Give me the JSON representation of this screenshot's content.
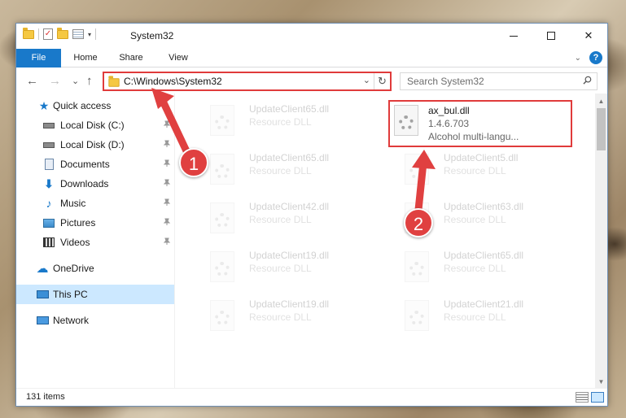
{
  "window": {
    "title": "System32",
    "qat_dropdown": "▾",
    "minimize_label": "",
    "maximize_label": "",
    "close_label": "✕"
  },
  "ribbon": {
    "tabs": [
      "File",
      "Home",
      "Share",
      "View"
    ],
    "collapse_chevron": "⌄",
    "help": "?"
  },
  "nav": {
    "back": "←",
    "forward": "→",
    "recent": "⌄",
    "up": "↑",
    "address": "C:\\Windows\\System32",
    "address_dropdown": "⌄",
    "refresh": "↻",
    "search_placeholder": "Search System32"
  },
  "sidebar": {
    "items": [
      {
        "label": "Quick access",
        "icon": "star-icon"
      },
      {
        "label": "Local Disk (C:)",
        "icon": "disk-icon",
        "pinned": true
      },
      {
        "label": "Local Disk (D:)",
        "icon": "disk-icon",
        "pinned": true
      },
      {
        "label": "Documents",
        "icon": "document-icon",
        "pinned": true
      },
      {
        "label": "Downloads",
        "icon": "download-icon",
        "pinned": true
      },
      {
        "label": "Music",
        "icon": "music-icon",
        "pinned": true
      },
      {
        "label": "Pictures",
        "icon": "pictures-icon",
        "pinned": true
      },
      {
        "label": "Videos",
        "icon": "videos-icon",
        "pinned": true
      },
      {
        "label": "OneDrive",
        "icon": "cloud-icon"
      },
      {
        "label": "This PC",
        "icon": "computer-icon",
        "selected": true
      },
      {
        "label": "Network",
        "icon": "network-icon"
      }
    ]
  },
  "files": [
    {
      "name": "UpdateClient65.dll",
      "type": "Resource DLL"
    },
    {
      "name": "ax_bul.dll",
      "version": "1.4.6.703",
      "description": "Alcohol multi-langu...",
      "highlighted": true
    },
    {
      "name": "UpdateClient65.dll",
      "type": "Resource DLL"
    },
    {
      "name": "UpdateClient5.dll",
      "type": "Resource DLL"
    },
    {
      "name": "UpdateClient42.dll",
      "type": "Resource DLL"
    },
    {
      "name": "UpdateClient63.dll",
      "type": "Resource DLL"
    },
    {
      "name": "UpdateClient19.dll",
      "type": "Resource DLL"
    },
    {
      "name": "UpdateClient65.dll",
      "type": "Resource DLL"
    },
    {
      "name": "UpdateClient19.dll",
      "type": "Resource DLL"
    },
    {
      "name": "UpdateClient21.dll",
      "type": "Resource DLL"
    }
  ],
  "status": {
    "item_count": "131 items"
  },
  "annotations": {
    "step1": "1",
    "step2": "2",
    "color": "#e04040"
  }
}
